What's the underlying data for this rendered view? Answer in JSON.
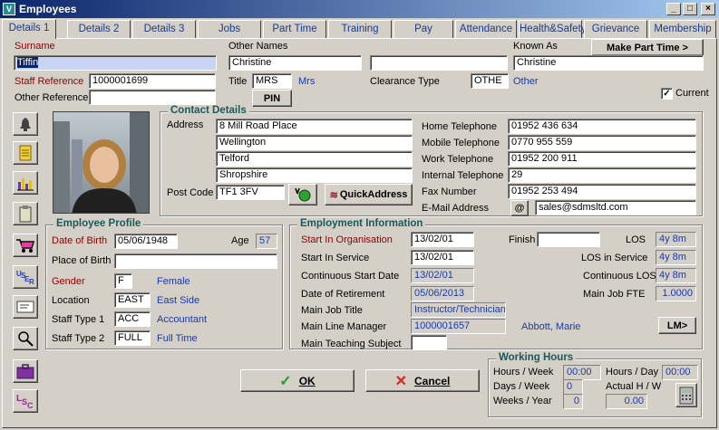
{
  "window": {
    "title": "Employees",
    "min": "_",
    "max": "□",
    "close": "×"
  },
  "tabs": [
    "Details 1",
    "Details 2",
    "Details 3",
    "Jobs",
    "Part Time",
    "Training",
    "Pay",
    "Attendance",
    "Health&Safety",
    "Grievance",
    "Membership"
  ],
  "top": {
    "surname_label": "Surname",
    "surname": "Tiffin",
    "other_names_label": "Other Names",
    "other_names": "Christine",
    "other_names2": "",
    "known_as_label": "Known As",
    "known_as": "Christine",
    "make_part_time": "Make Part Time >",
    "staff_ref_label": "Staff Reference",
    "staff_ref": "1000001699",
    "title_label": "Title",
    "title": "MRS",
    "title_desc": "Mrs",
    "clearance_label": "Clearance Type",
    "clearance": "OTHE",
    "clearance_desc": "Other",
    "other_ref_label": "Other Reference",
    "other_ref": "",
    "pin": "PIN",
    "current_label": "Current",
    "current_check": "✓"
  },
  "contact": {
    "title": "Contact Details",
    "address_label": "Address",
    "address": [
      "8 Mill Road Place",
      "Wellington",
      "Telford",
      "Shropshire"
    ],
    "postcode_label": "Post Code",
    "postcode": "TF1 3FV",
    "quick_address": "QuickAddress",
    "home_label": "Home Telephone",
    "home": "01952 436 634",
    "mobile_label": "Mobile Telephone",
    "mobile": "0770 955 559",
    "work_label": "Work Telephone",
    "work": "01952 200 911",
    "internal_label": "Internal Telephone",
    "internal": "29",
    "fax_label": "Fax Number",
    "fax": "01952 253 494",
    "email_label": "E-Mail Address",
    "email_btn": "@",
    "email": "sales@sdmsltd.com"
  },
  "profile": {
    "title": "Employee Profile",
    "dob_label": "Date of Birth",
    "dob": "05/06/1948",
    "age_label": "Age",
    "age": "57",
    "pob_label": "Place of Birth",
    "pob": "",
    "gender_label": "Gender",
    "gender": "F",
    "gender_desc": "Female",
    "location_label": "Location",
    "location": "EAST",
    "location_desc": "East Side",
    "st1_label": "Staff Type 1",
    "st1": "ACC",
    "st1_desc": "Accountant",
    "st2_label": "Staff Type 2",
    "st2": "FULL",
    "st2_desc": "Full Time"
  },
  "employment": {
    "title": "Employment Information",
    "start_org_label": "Start In Organisation",
    "start_org": "13/02/01",
    "finish_label": "Finish",
    "finish": "",
    "los_label": "LOS",
    "los": "4y 8m",
    "start_service_label": "Start In Service",
    "start_service": "13/02/01",
    "los_service_label": "LOS in Service",
    "los_service": "4y 8m",
    "cont_start_label": "Continuous Start Date",
    "cont_start": "13/02/01",
    "cont_los_label": "Continuous LOS",
    "cont_los": "4y 8m",
    "retire_label": "Date of Retirement",
    "retire": "05/06/2013",
    "fte_label": "Main Job FTE",
    "fte": "1.0000",
    "job_title_label": "Main Job Title",
    "job_title": "Instructor/Technician",
    "manager_label": "Main Line Manager",
    "manager_id": "1000001657",
    "manager_name": "Abbott, Marie",
    "lm_btn": "LM>",
    "teaching_label": "Main Teaching Subject",
    "teaching": ""
  },
  "hours": {
    "title": "Working Hours",
    "hw_label": "Hours / Week",
    "hw": "00:00",
    "hd_label": "Hours / Day",
    "hd": "00:00",
    "dw_label": "Days / Week",
    "dw": "0",
    "actual_label": "Actual H / W",
    "wy_label": "Weeks / Year",
    "wy": "0",
    "actual": "0.00"
  },
  "buttons": {
    "ok": "OK",
    "cancel": "Cancel"
  },
  "icons": {
    "ok_check": "✓",
    "cancel_x": "✕"
  }
}
